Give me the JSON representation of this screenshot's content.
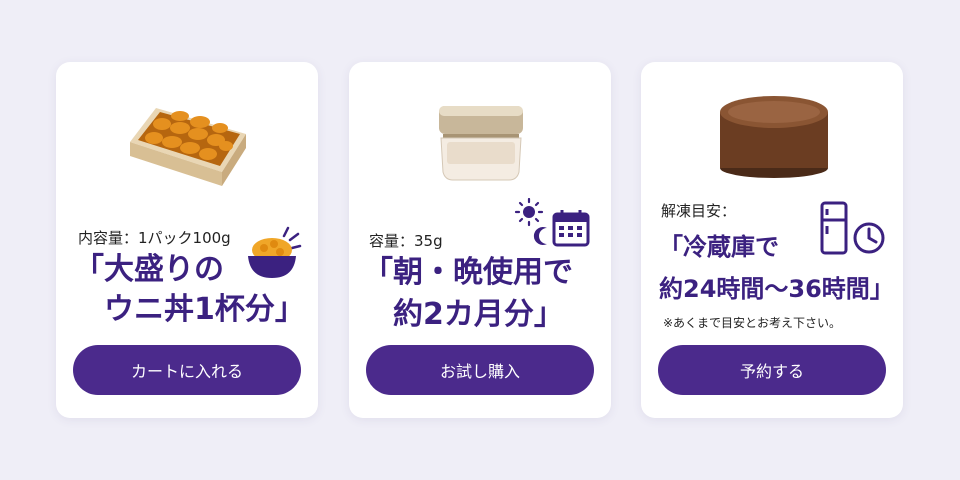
{
  "colors": {
    "accent": "#4b2a8c",
    "headline": "#3b2180",
    "background": "#efeef7",
    "card": "#ffffff"
  },
  "cards": [
    {
      "image": "sea-urchin-box",
      "spec_label": "内容量：1パック100g",
      "headline": [
        "「大盛りの",
        "　ウニ丼1杯分」"
      ],
      "icon": "rice-bowl-icon",
      "button_label": "カートに入れる"
    },
    {
      "image": "cream-jar",
      "spec_label": "容量：35g",
      "headline": [
        "「朝・晩使用で",
        "　約2カ月分」"
      ],
      "icons": [
        "sun-moon-icon",
        "calendar-icon"
      ],
      "button_label": "お試し購入"
    },
    {
      "image": "chocolate-cake",
      "spec_label": "解凍目安：",
      "headline": [
        "「冷蔵庫で",
        "約24時間〜36時間」"
      ],
      "icons": [
        "refrigerator-icon",
        "clock-icon"
      ],
      "note": "※あくまで目安とお考え下さい。",
      "button_label": "予約する"
    }
  ]
}
